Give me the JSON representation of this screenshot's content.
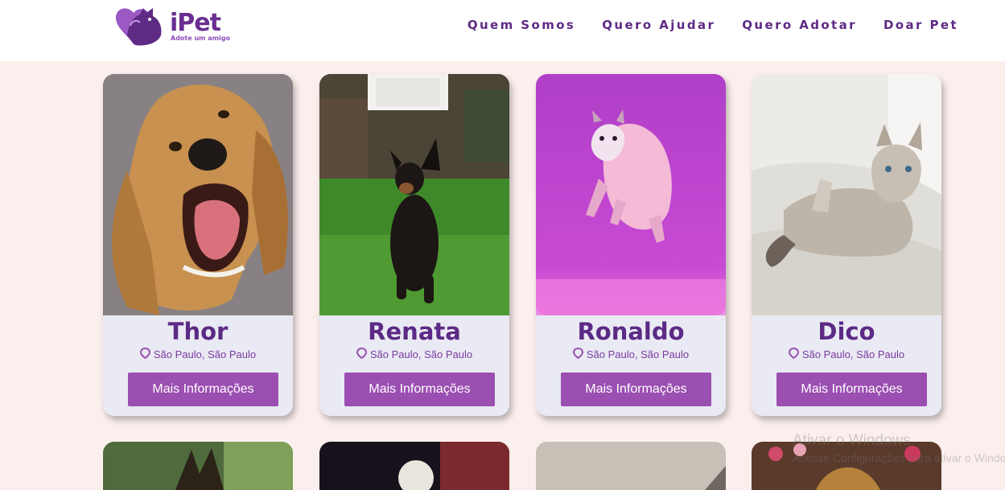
{
  "header": {
    "logo_text": "iPet",
    "logo_tagline": "Adote um amigo",
    "nav": [
      "Quem Somos",
      "Quero Ajudar",
      "Quero Adotar",
      "Doar Pet"
    ]
  },
  "pets": [
    {
      "name": "Thor",
      "location": "São Paulo, São Paulo",
      "button": "Mais Informações"
    },
    {
      "name": "Renata",
      "location": "São Paulo, São Paulo",
      "button": "Mais Informações"
    },
    {
      "name": "Ronaldo",
      "location": "São Paulo, São Paulo",
      "button": "Mais Informações"
    },
    {
      "name": "Dico",
      "location": "São Paulo, São Paulo",
      "button": "Mais Informações"
    }
  ],
  "watermark": {
    "line1": "Ativar o Windows",
    "line2": "Acesse Configurações para ativar o Windows."
  },
  "colors": {
    "brand_purple": "#5c2a85",
    "button_purple": "#9b4fb1",
    "page_background": "#fbefed",
    "card_background": "#e9eaf3"
  }
}
